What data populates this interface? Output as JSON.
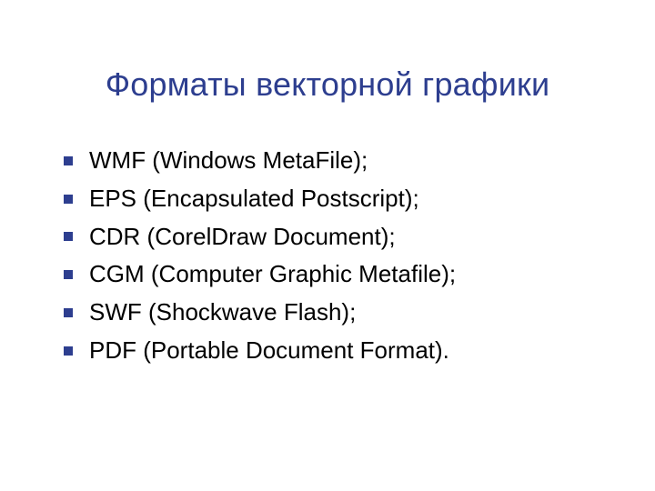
{
  "title": "Форматы векторной графики",
  "items": [
    "WMF (Windows MetaFile);",
    "EPS (Encapsulated Postscript);",
    "CDR (CorelDraw Document);",
    "CGM (Computer Graphic Metafile);",
    "SWF (Shockwave Flash);",
    "PDF (Portable Document Format)."
  ]
}
